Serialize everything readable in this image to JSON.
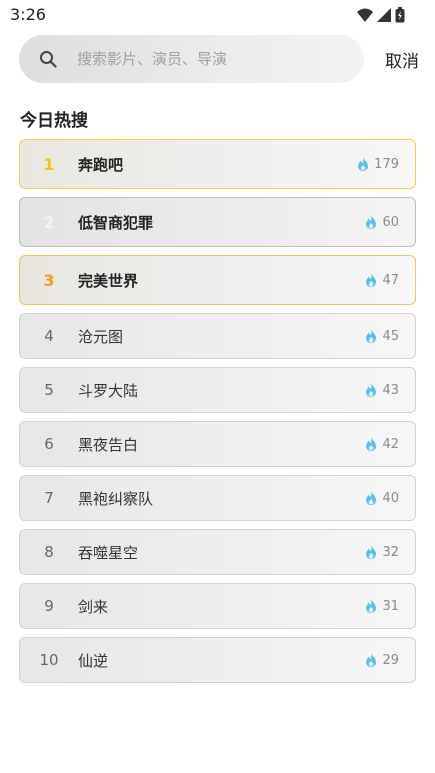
{
  "status_bar": {
    "time": "3:26",
    "icons": [
      "wifi-icon",
      "signal-icon",
      "battery-icon"
    ]
  },
  "search": {
    "placeholder": "搜索影片、演员、导演",
    "value": "",
    "icon": "search-icon",
    "cancel_label": "取消"
  },
  "section_title": "今日热搜",
  "colors": {
    "gold": "#f3c417",
    "silver": "#f4f4f4",
    "bronze": "#ef9f1c",
    "flame": "#5bc0eb"
  },
  "hot_list": [
    {
      "rank": "1",
      "title": "奔跑吧",
      "count": "179"
    },
    {
      "rank": "2",
      "title": "低智商犯罪",
      "count": "60"
    },
    {
      "rank": "3",
      "title": "完美世界",
      "count": "47"
    },
    {
      "rank": "4",
      "title": "沧元图",
      "count": "45"
    },
    {
      "rank": "5",
      "title": "斗罗大陆",
      "count": "43"
    },
    {
      "rank": "6",
      "title": "黑夜告白",
      "count": "42"
    },
    {
      "rank": "7",
      "title": "黑袍纠察队",
      "count": "40"
    },
    {
      "rank": "8",
      "title": "吞噬星空",
      "count": "32"
    },
    {
      "rank": "9",
      "title": "剑来",
      "count": "31"
    },
    {
      "rank": "10",
      "title": "仙逆",
      "count": "29"
    }
  ]
}
